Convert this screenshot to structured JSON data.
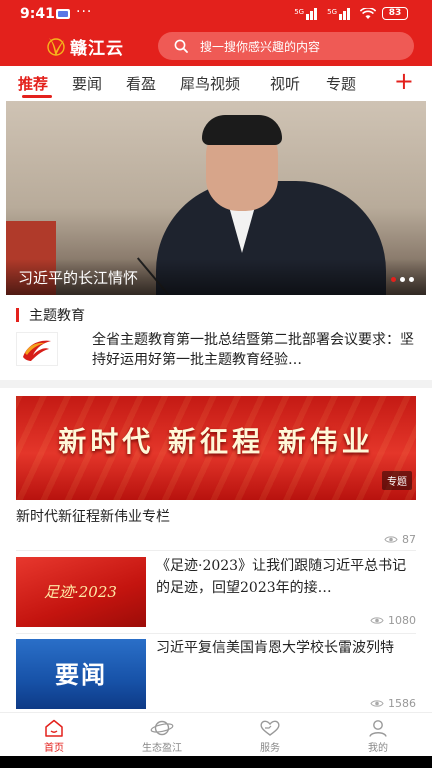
{
  "status_bar": {
    "time": "9:41",
    "dots": "···",
    "signal_label": "5G",
    "battery": "83"
  },
  "header": {
    "logo_text": "赣江云",
    "search_placeholder": "搜一搜你感兴趣的内容"
  },
  "tabs": [
    {
      "label": "推荐",
      "active": true
    },
    {
      "label": "要闻"
    },
    {
      "label": "看盈"
    },
    {
      "label": "犀鸟视频"
    },
    {
      "label": "视听"
    },
    {
      "label": "专题"
    }
  ],
  "tabs_add_label": "+",
  "hero": {
    "caption": "习近平的长江情怀"
  },
  "theme_section": {
    "title": "主题教育",
    "item_text": "全省主题教育第一批总结暨第二批部署会议要求：坚持好运用好第一批主题教育经验…"
  },
  "banner": {
    "slogan": "新时代 新征程 新伟业",
    "tag": "专题",
    "title": "新时代新征程新伟业专栏",
    "views": "87"
  },
  "news": [
    {
      "thumb_text": "足迹·2023",
      "title": "《足迹·2023》让我们跟随习近平总书记的足迹，回望2023年的接…",
      "views": "1080"
    },
    {
      "thumb_text": "要闻",
      "title": "习近平复信美国肯恩大学校长雷波列特",
      "views": "1586"
    }
  ],
  "bottom_nav": [
    {
      "label": "首页",
      "icon": "home-icon",
      "active": true
    },
    {
      "label": "生态盈江",
      "icon": "planet-icon"
    },
    {
      "label": "服务",
      "icon": "heart-hands-icon"
    },
    {
      "label": "我的",
      "icon": "user-icon"
    }
  ],
  "colors": {
    "brand": "#e3211c",
    "search_bg": "#ef5a55",
    "muted": "#999999"
  }
}
